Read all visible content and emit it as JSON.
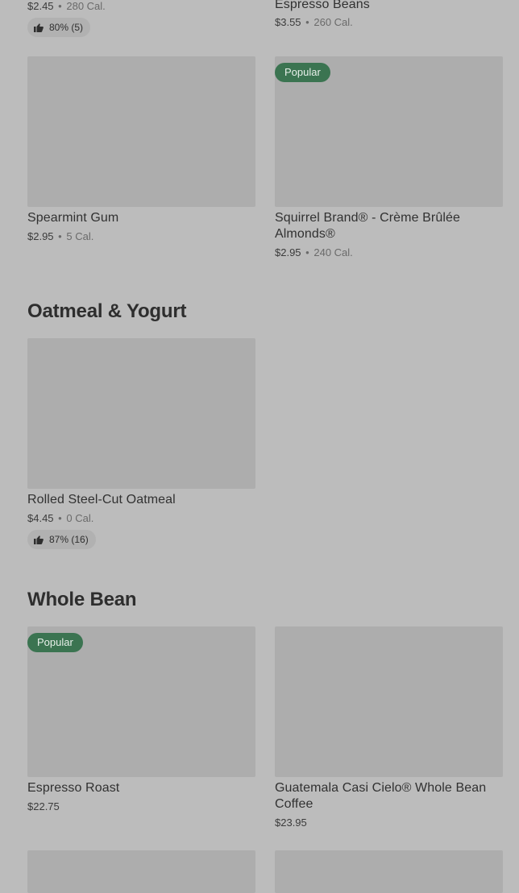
{
  "top_partial": {
    "left_item": {
      "price": "$2.45",
      "calories": "280 Cal.",
      "rating": "80% (5)"
    },
    "right_item": {
      "name": "Espresso Beans",
      "price": "$3.55",
      "calories": "260 Cal."
    }
  },
  "row_gum_almonds": {
    "left_item": {
      "name": "Spearmint Gum",
      "price": "$2.95",
      "calories": "5 Cal."
    },
    "right_item": {
      "badge": "Popular",
      "name": "Squirrel Brand® - Crème Brûlée Almonds®",
      "price": "$2.95",
      "calories": "240 Cal."
    }
  },
  "section_oatmeal": {
    "title": "Oatmeal & Yogurt",
    "item": {
      "name": "Rolled Steel-Cut Oatmeal",
      "price": "$4.45",
      "calories": "0 Cal.",
      "rating": "87% (16)"
    }
  },
  "section_whole_bean": {
    "title": "Whole Bean",
    "left_item": {
      "badge": "Popular",
      "name": "Espresso Roast",
      "price": "$22.75"
    },
    "right_item": {
      "name": "Guatemala Casi Cielo® Whole Bean Coffee",
      "price": "$23.95"
    }
  },
  "meta_separator": "•",
  "colors": {
    "background": "#bcbcbc",
    "image_placeholder": "#adadad",
    "badge_bg": "#3b7451",
    "rating_bg": "#b1b1b1"
  },
  "icons": {
    "rating": "thumbs-up-icon"
  }
}
